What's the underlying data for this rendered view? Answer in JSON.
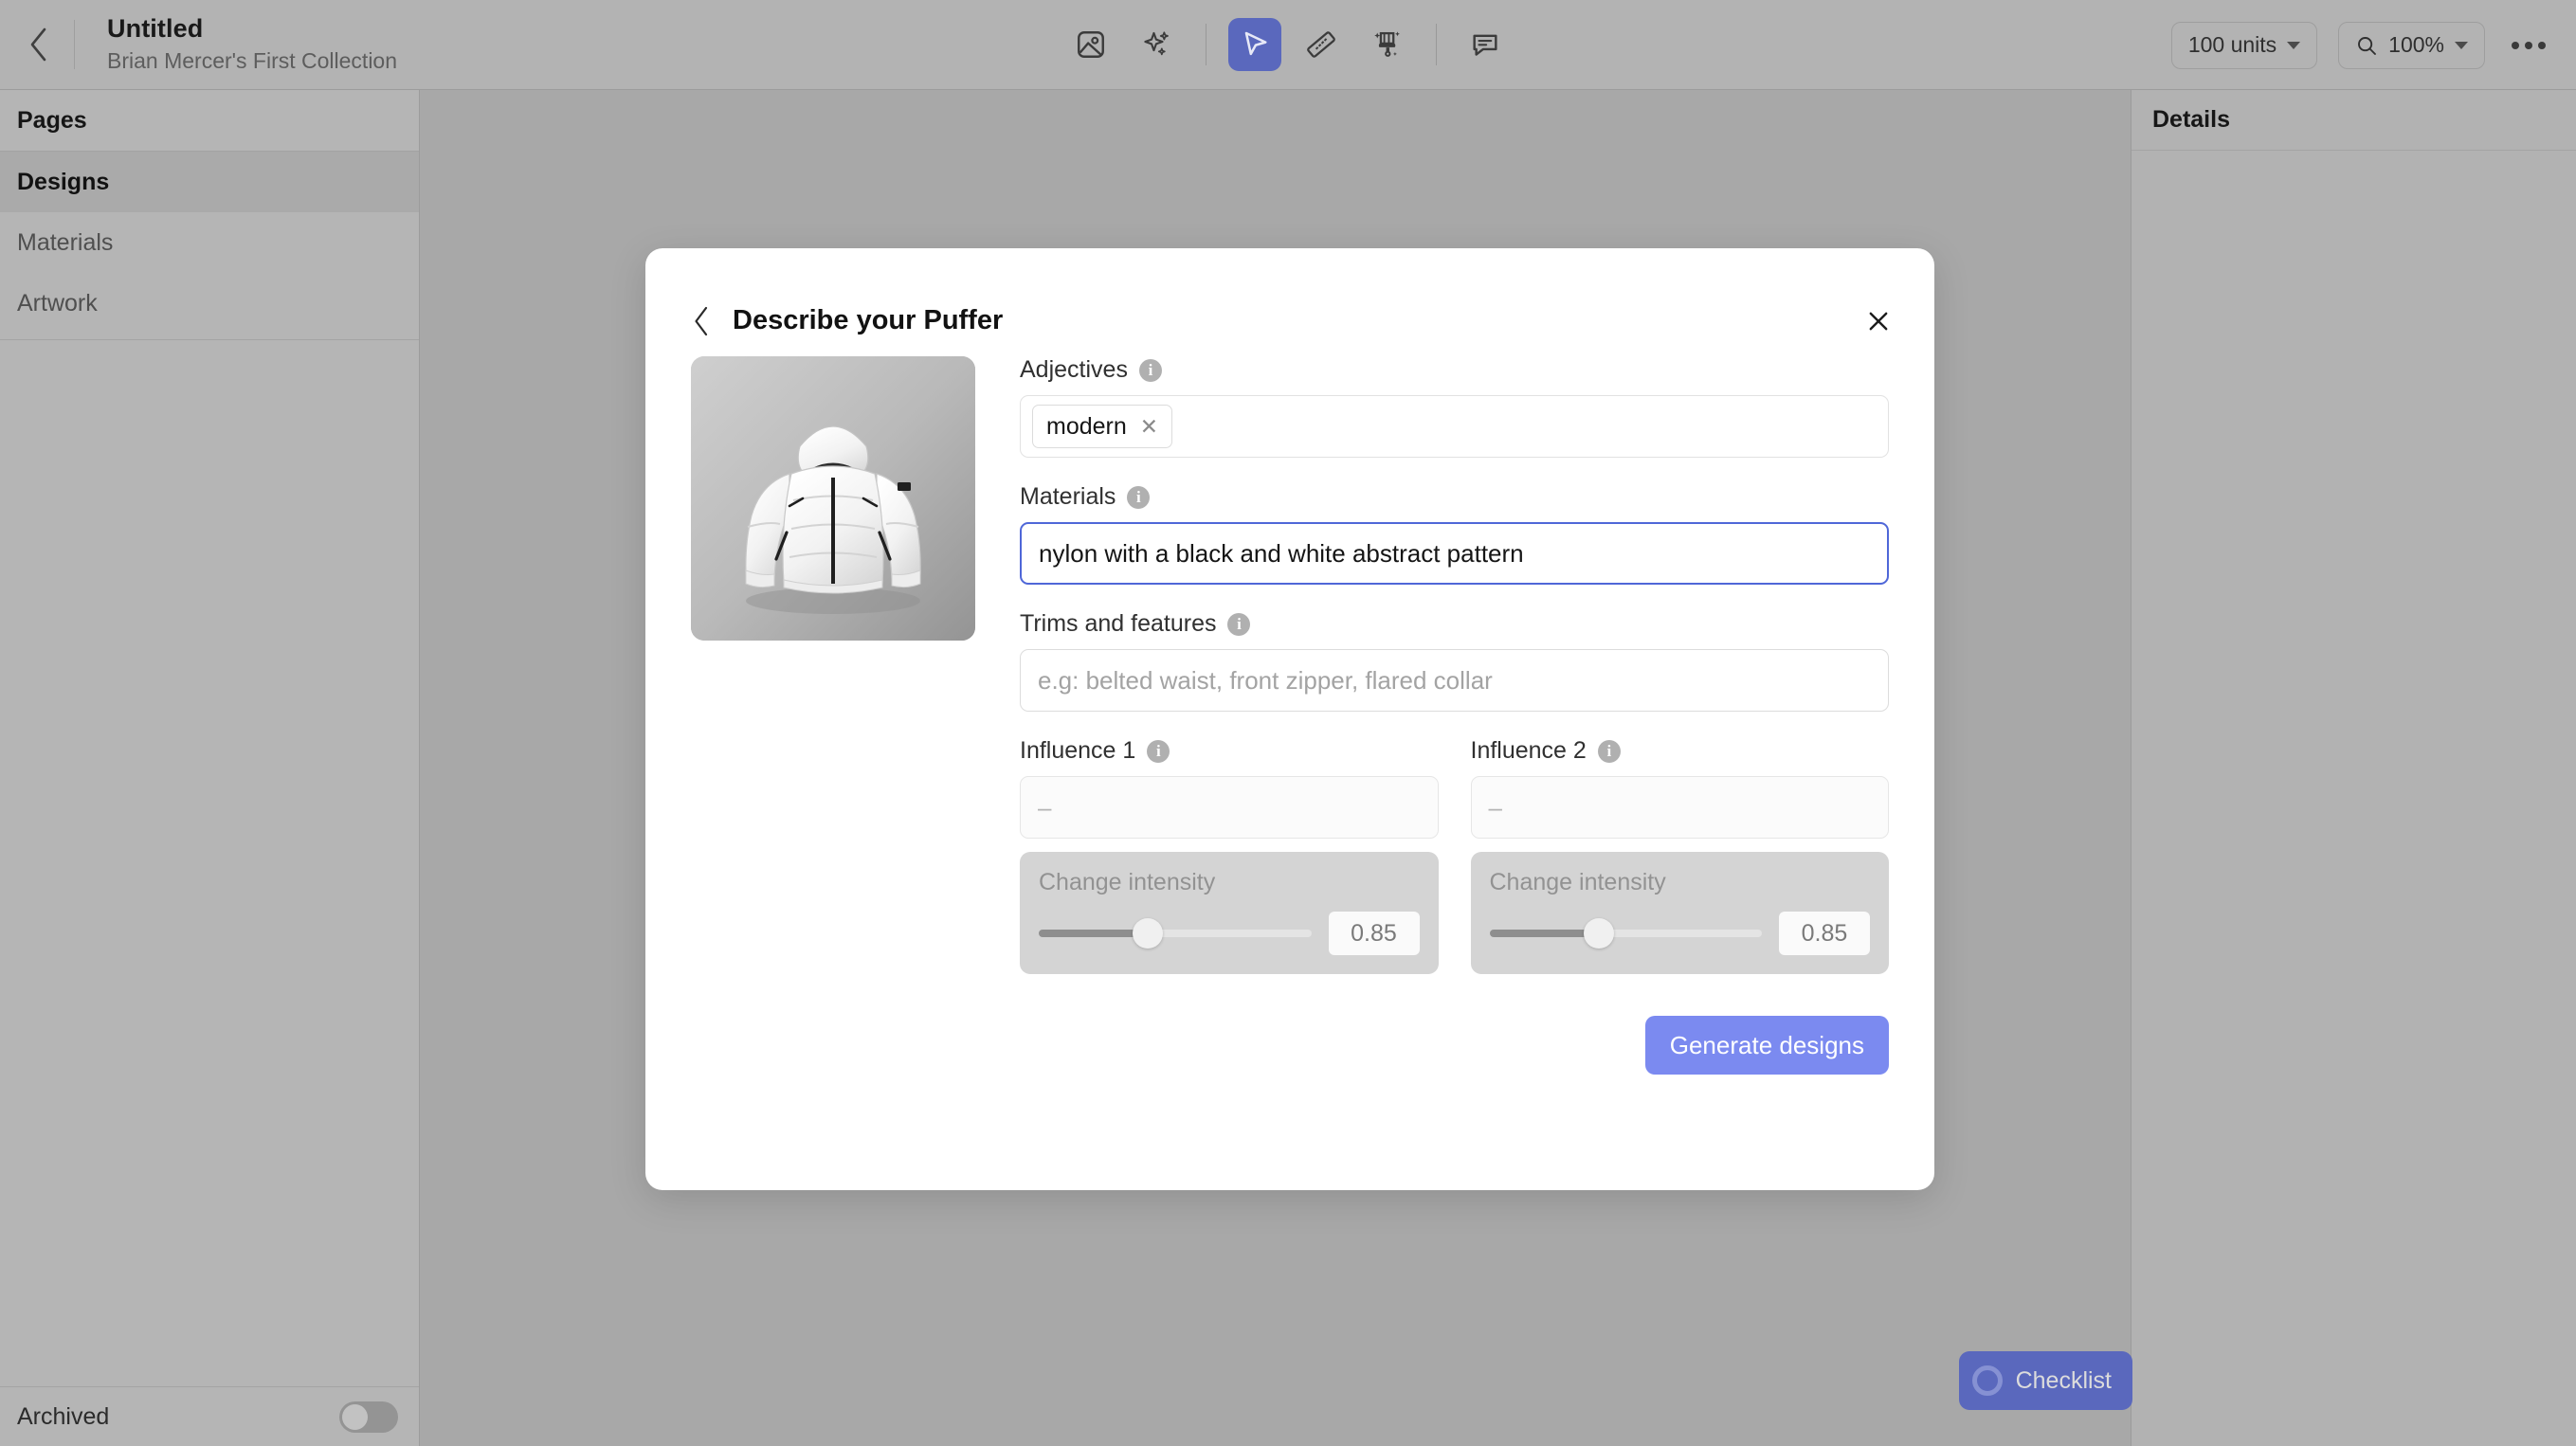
{
  "topbar": {
    "back_icon": "chevron-left-icon",
    "title": "Untitled",
    "subtitle": "Brian Mercer's First Collection",
    "tools": [
      {
        "name": "image-icon",
        "active": false
      },
      {
        "name": "sparkle-ai-icon",
        "active": false
      },
      {
        "name": "cursor-select-icon",
        "active": true
      },
      {
        "name": "ruler-measure-icon",
        "active": false
      },
      {
        "name": "paintbrush-icon",
        "active": false
      },
      {
        "name": "comment-icon",
        "active": false
      }
    ],
    "units_value": "100 units",
    "zoom_icon": "search-icon",
    "zoom_value": "100%",
    "more_icon": "kebab-more-icon"
  },
  "sidebar": {
    "items": [
      {
        "label": "Pages",
        "state": "strong"
      },
      {
        "label": "Designs",
        "state": "active"
      },
      {
        "label": "Materials",
        "state": "normal"
      },
      {
        "label": "Artwork",
        "state": "normal"
      }
    ],
    "archived_label": "Archived",
    "archived_on": false
  },
  "right_panel": {
    "title": "Details"
  },
  "modal": {
    "back_icon": "chevron-left-icon",
    "title": "Describe your Puffer",
    "close_icon": "close-x-icon",
    "thumbnail_alt": "white-puffer-jacket-thumbnail",
    "fields": {
      "adjectives": {
        "label": "Adjectives",
        "info_icon": "info-icon",
        "tags": [
          "modern"
        ],
        "tag_remove_icon": "tag-remove-x-icon"
      },
      "materials": {
        "label": "Materials",
        "info_icon": "info-icon",
        "value": "nylon with a black and white abstract pattern",
        "focused": true
      },
      "trims": {
        "label": "Trims and features",
        "info_icon": "info-icon",
        "value": "",
        "placeholder": "e.g: belted waist, front zipper, flared collar"
      },
      "influence_1": {
        "label": "Influence 1",
        "info_icon": "info-icon",
        "placeholder": "–",
        "intensity_label": "Change intensity",
        "intensity_value": "0.85",
        "slider_percent": 40
      },
      "influence_2": {
        "label": "Influence 2",
        "info_icon": "info-icon",
        "placeholder": "–",
        "intensity_label": "Change intensity",
        "intensity_value": "0.85",
        "slider_percent": 40
      }
    },
    "generate_label": "Generate designs"
  },
  "checklist": {
    "icon": "progress-ring-icon",
    "label": "Checklist"
  },
  "colors": {
    "accent_primary": "#7b8af0",
    "accent_tool": "#5a68bd",
    "focus_border": "#4f67d8",
    "canvas_bg": "#a8a8a8",
    "sidebar_bg": "#b5b5b5"
  }
}
